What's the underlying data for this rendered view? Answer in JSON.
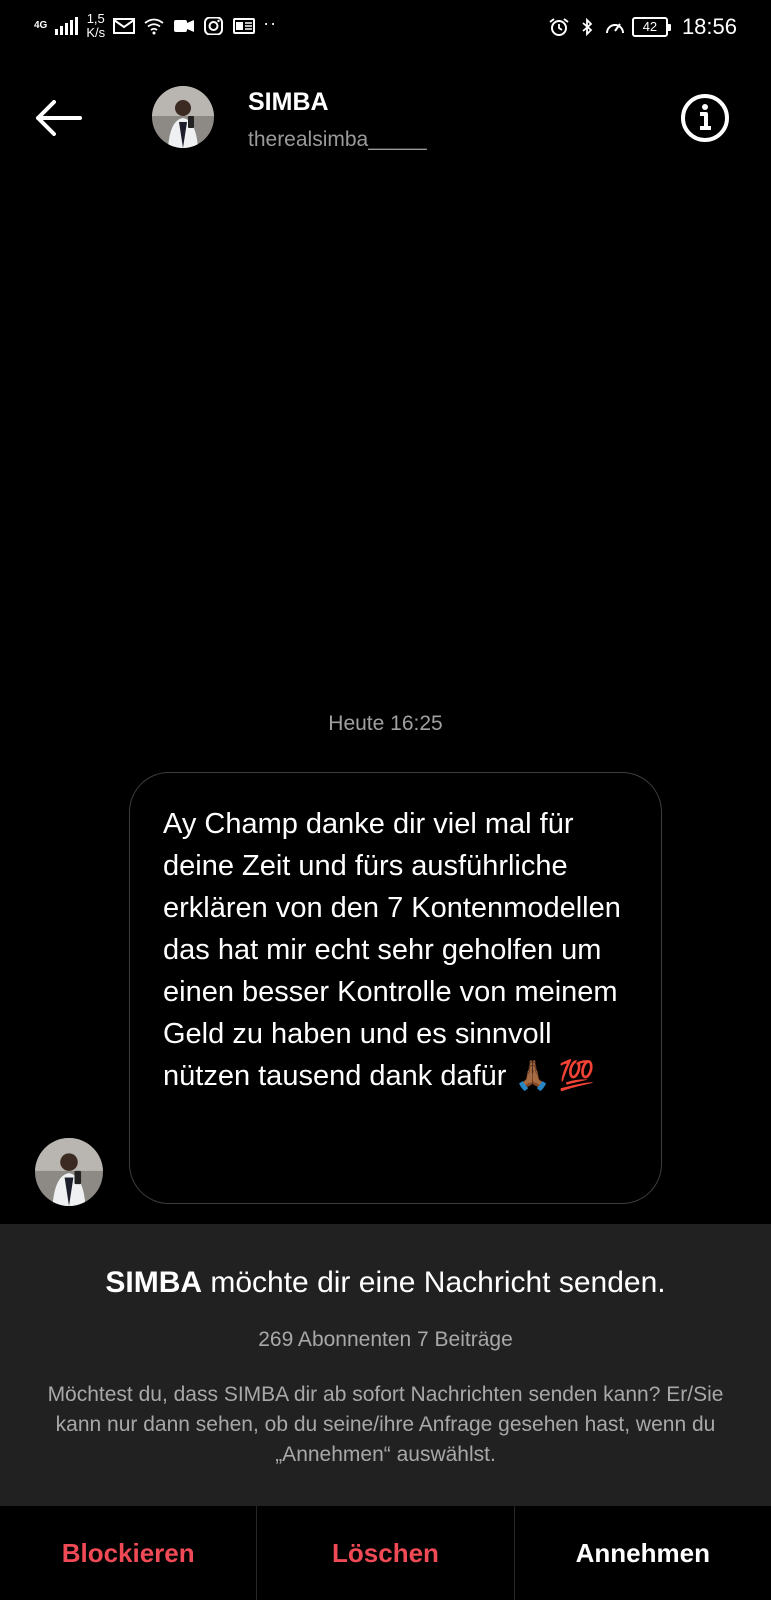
{
  "status_bar": {
    "network": "4G",
    "speed_value": "1,5",
    "speed_unit": "K/s",
    "battery": "42",
    "time": "18:56"
  },
  "header": {
    "name": "SIMBA",
    "handle": "therealsimba_____"
  },
  "conversation": {
    "timestamp": "Heute 16:25",
    "message": "Ay Champ danke dir viel mal für deine Zeit und fürs ausführliche erklären von den 7 Kontenmodellen das hat mir echt sehr geholfen um einen besser Kontrolle von meinem Geld zu haben und es sinnvoll nützen tausend dank dafür 🙏🏾 💯"
  },
  "request": {
    "title_name": "SIMBA",
    "title_rest": " möchte dir eine Nachricht senden.",
    "stats": "269 Abonnenten 7 Beiträge",
    "description": "Möchtest du, dass SIMBA dir ab sofort Nachrichten senden kann? Er/Sie kann nur dann sehen, ob du seine/ihre Anfrage gesehen hast, wenn du „Annehmen“ auswählst."
  },
  "actions": {
    "block": "Blockieren",
    "delete": "Löschen",
    "accept": "Annehmen"
  },
  "colors": {
    "background": "#000000",
    "panel": "#212121",
    "danger": "#ef4a55",
    "muted_text": "#a8a8a8"
  },
  "icons": [
    "back-arrow-icon",
    "info-icon",
    "mail-icon",
    "wifi-icon",
    "alarm-icon",
    "bluetooth-icon",
    "speedometer-icon"
  ]
}
